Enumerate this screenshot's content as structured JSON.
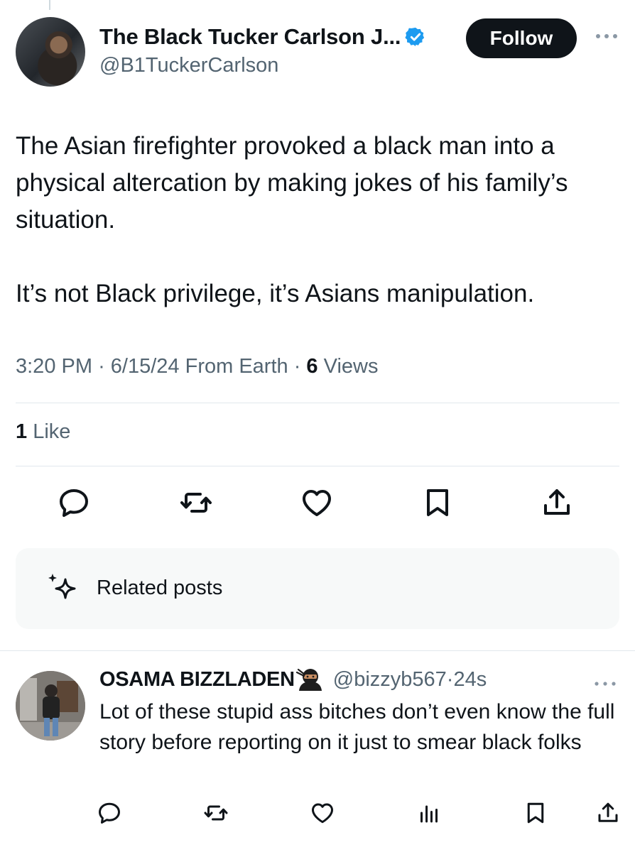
{
  "tweet": {
    "author": {
      "display_name": "The Black Tucker Carlson J...",
      "handle": "@B1TuckerCarlson",
      "verified": true
    },
    "follow_label": "Follow",
    "text_paragraph_1": "The Asian firefighter provoked a black man into a physical altercation by making jokes of his family’s situation.",
    "text_paragraph_2": "It’s not Black privilege, it’s Asians manipulation.",
    "meta": {
      "time": "3:20 PM",
      "date": "6/15/24",
      "source": "From Earth",
      "views_count": "6",
      "views_label": "Views"
    },
    "likes": {
      "count": "1",
      "label": "Like"
    },
    "actions": [
      "reply-icon",
      "retweet-icon",
      "like-icon",
      "bookmark-icon",
      "share-icon"
    ]
  },
  "related": {
    "label": "Related posts",
    "icon": "sparkle-icon"
  },
  "reply": {
    "display_name": "OSAMA BIZZLADEN",
    "emoji": "ninja-icon",
    "handle": "@bizzyb567",
    "separator": "·",
    "age": "24s",
    "text": "Lot of these stupid ass bitches don’t even know the full story before reporting on it just to smear black folks",
    "actions": [
      "reply-icon",
      "retweet-icon",
      "like-icon",
      "views-icon",
      "bookmark-icon",
      "share-icon"
    ]
  },
  "colors": {
    "text": "#0f1419",
    "secondary": "#536471",
    "verified": "#1d9bf0",
    "divider": "#e1e8ed",
    "card_bg": "#f7f9f9"
  }
}
